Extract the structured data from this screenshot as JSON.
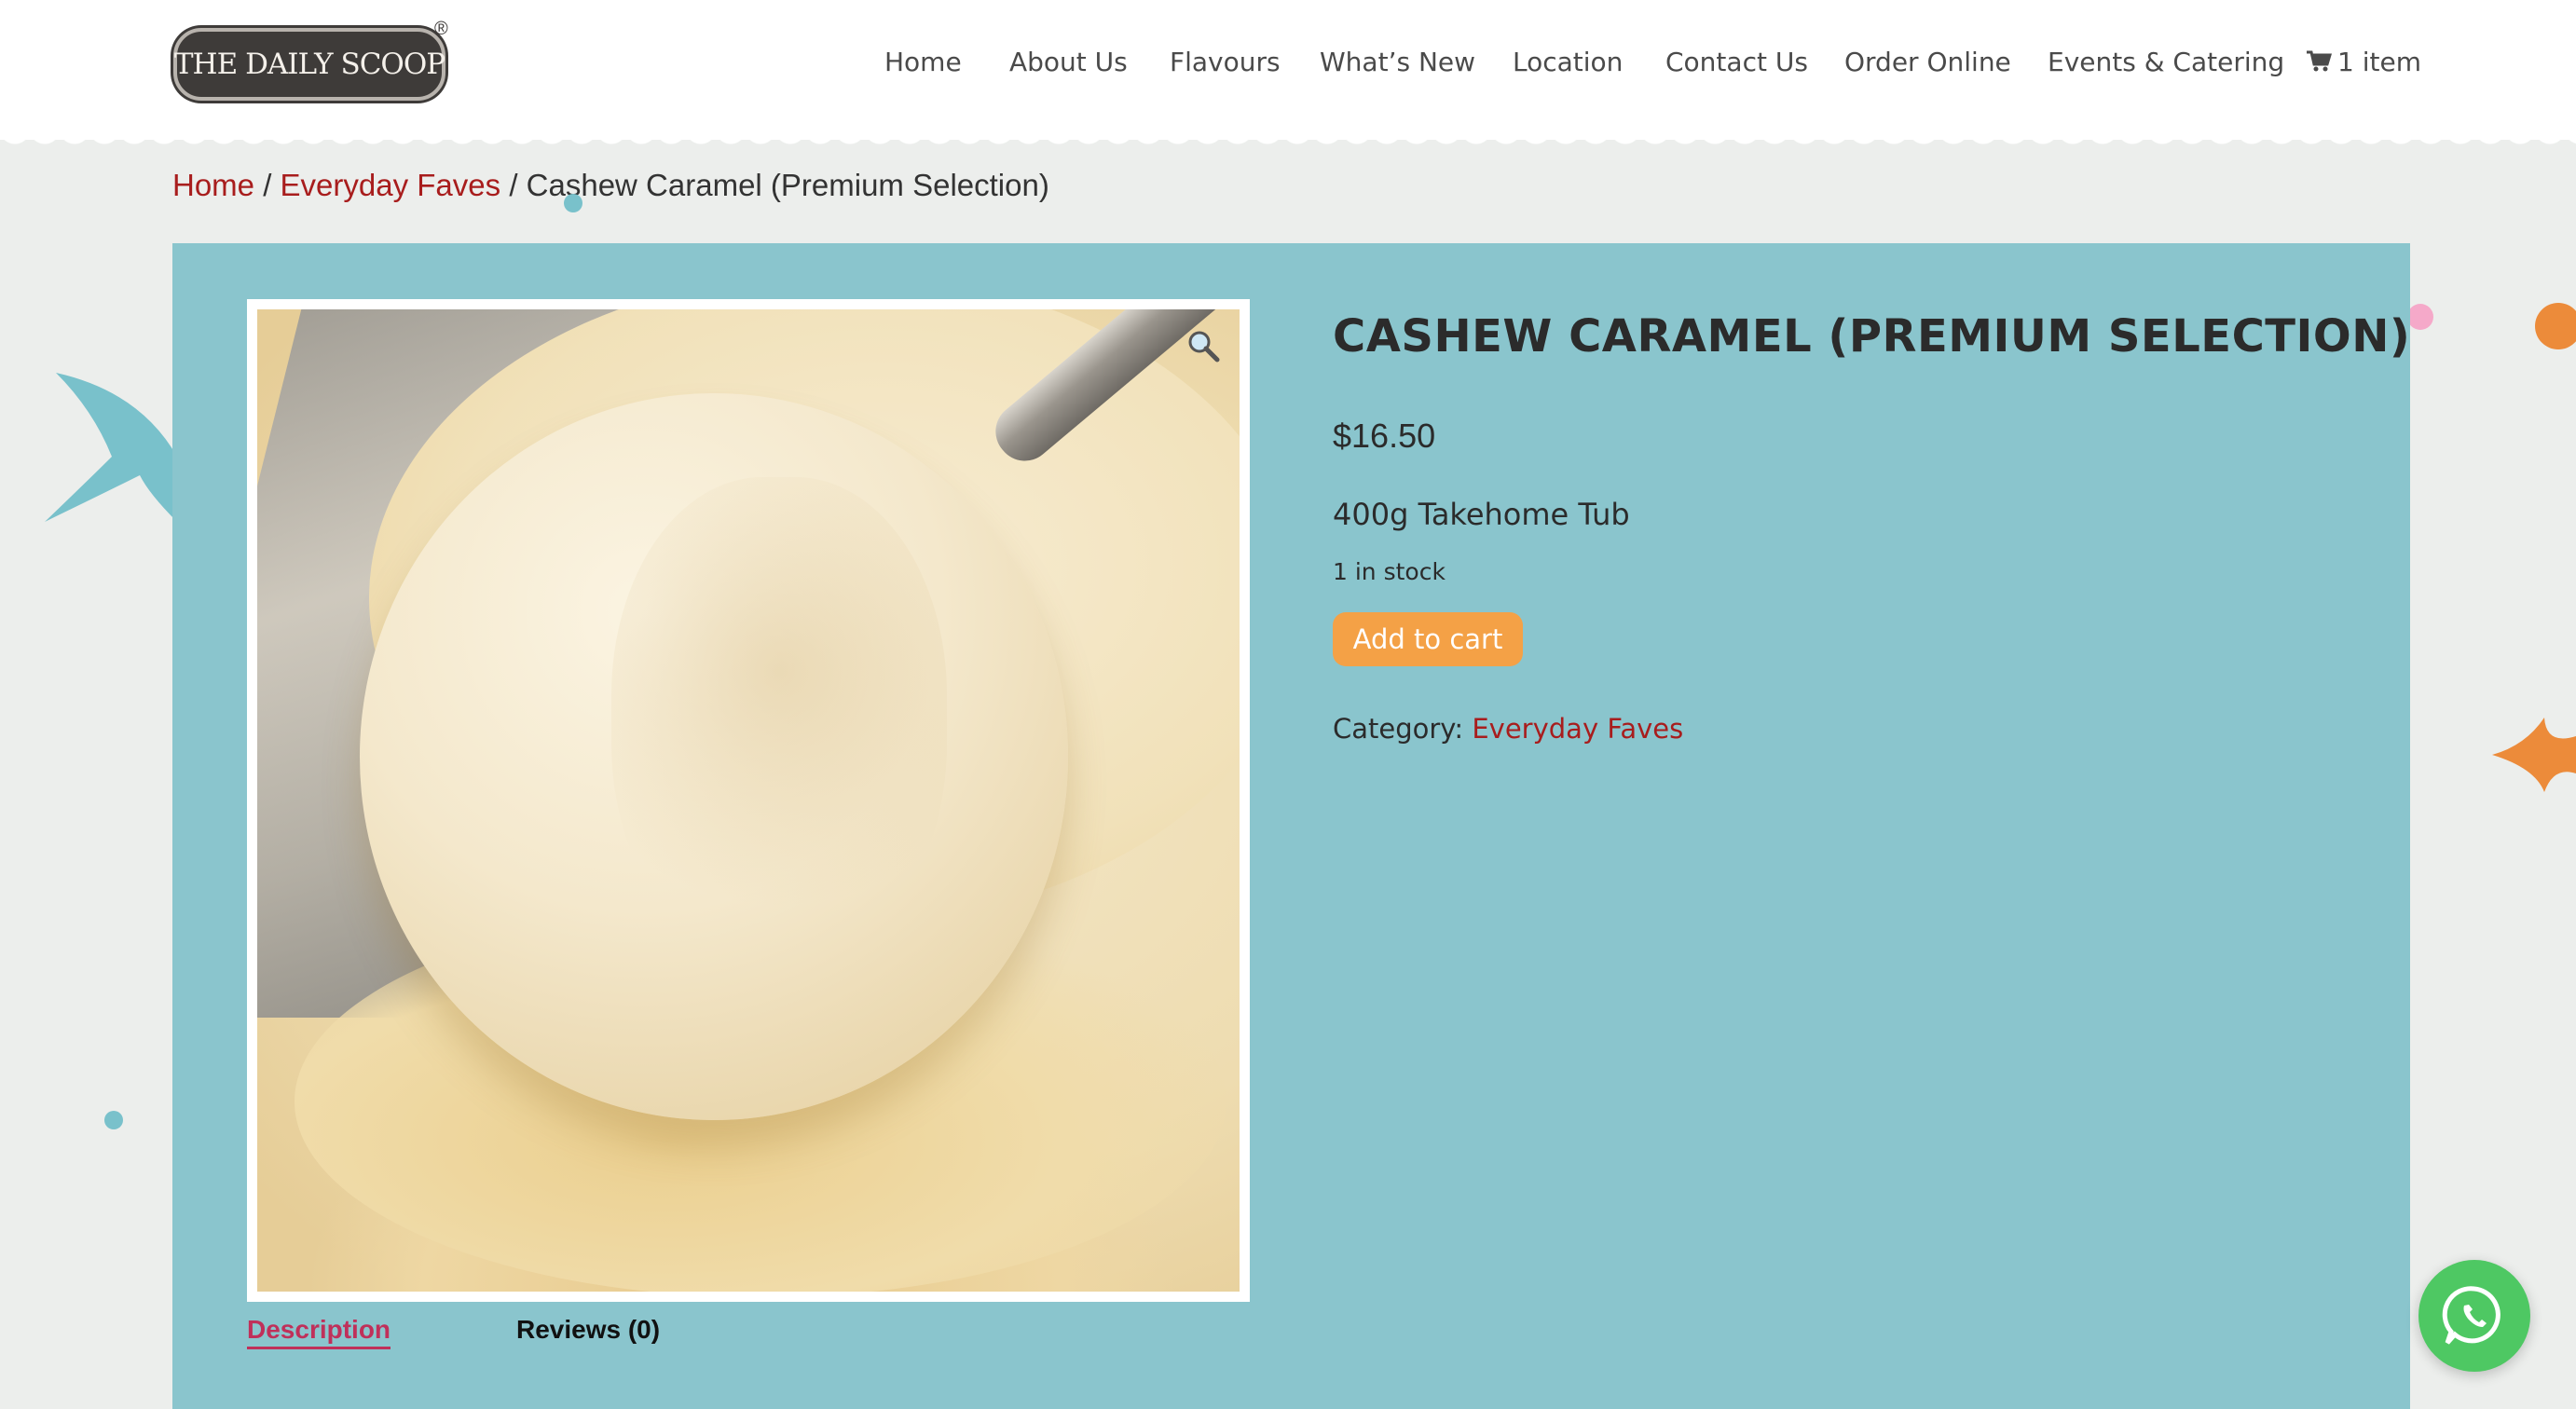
{
  "brand": {
    "name": "THE DAILY SCOOP",
    "registered_mark": "®"
  },
  "nav": {
    "items": [
      "Home",
      "About Us",
      "Flavours",
      "What’s New",
      "Location",
      "Contact Us",
      "Order Online",
      "Events & Catering"
    ],
    "cart_label": "1 item"
  },
  "breadcrumb": {
    "home": "Home",
    "category": "Everyday Faves",
    "separator": "/",
    "current": "Cashew Caramel (Premium Selection)"
  },
  "product": {
    "title": "CASHEW CARAMEL (PREMIUM SELECTION)",
    "price": "$16.50",
    "variant": "400g Takehome Tub",
    "stock": "1 in stock",
    "add_to_cart": "Add to cart",
    "category_label": "Category:",
    "category_link": "Everyday Faves"
  },
  "tabs": {
    "description": "Description",
    "reviews": "Reviews (0)"
  },
  "colors": {
    "panel": "#8ac5cd",
    "link": "#a81d1d",
    "button": "#f4a146",
    "active_tab": "#c0305a",
    "whatsapp": "#4ec863"
  }
}
